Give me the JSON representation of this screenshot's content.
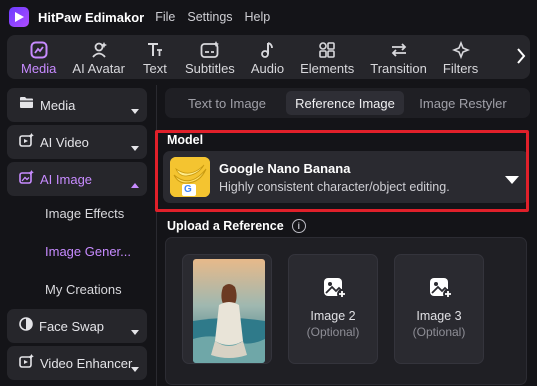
{
  "app": {
    "name": "HitPaw Edimakor"
  },
  "menu": [
    {
      "label": "File"
    },
    {
      "label": "Settings"
    },
    {
      "label": "Help"
    }
  ],
  "toolbar": {
    "items": [
      {
        "label": "Media",
        "icon": "media-icon",
        "active": true
      },
      {
        "label": "AI Avatar",
        "icon": "ai-avatar-icon",
        "active": false
      },
      {
        "label": "Text",
        "icon": "text-icon",
        "active": false
      },
      {
        "label": "Subtitles",
        "icon": "subtitles-icon",
        "active": false
      },
      {
        "label": "Audio",
        "icon": "audio-icon",
        "active": false
      },
      {
        "label": "Elements",
        "icon": "elements-icon",
        "active": false
      },
      {
        "label": "Transition",
        "icon": "transition-icon",
        "active": false
      },
      {
        "label": "Filters",
        "icon": "filters-icon",
        "active": false
      }
    ]
  },
  "sidebar": {
    "items": [
      {
        "label": "Media",
        "icon": "folder-icon"
      },
      {
        "label": "AI Video",
        "icon": "ai-video-icon"
      },
      {
        "label": "AI Image",
        "icon": "ai-image-icon",
        "expanded": true
      },
      {
        "label": "Face Swap",
        "icon": "face-swap-icon"
      },
      {
        "label": "Video Enhancer",
        "icon": "video-enhancer-icon"
      }
    ],
    "sub_items": [
      {
        "label": "Image Effects",
        "active": false
      },
      {
        "label": "Image Gener...",
        "active": true
      },
      {
        "label": "My Creations",
        "active": false
      }
    ]
  },
  "tabs": [
    {
      "label": "Text to Image",
      "active": false
    },
    {
      "label": "Reference Image",
      "active": true
    },
    {
      "label": "Image Restyler",
      "active": false
    }
  ],
  "model": {
    "section_label": "Model",
    "name": "Google Nano Banana",
    "description": "Highly consistent character/object editing."
  },
  "upload": {
    "section_label": "Upload a Reference",
    "slots": [
      {
        "title": "Image 2",
        "subtitle": "(Optional)"
      },
      {
        "title": "Image 3",
        "subtitle": "(Optional)"
      }
    ]
  },
  "colors": {
    "accent": "#c78bff",
    "highlight": "#e0202a",
    "panel": "#26262b",
    "background": "#141418"
  }
}
